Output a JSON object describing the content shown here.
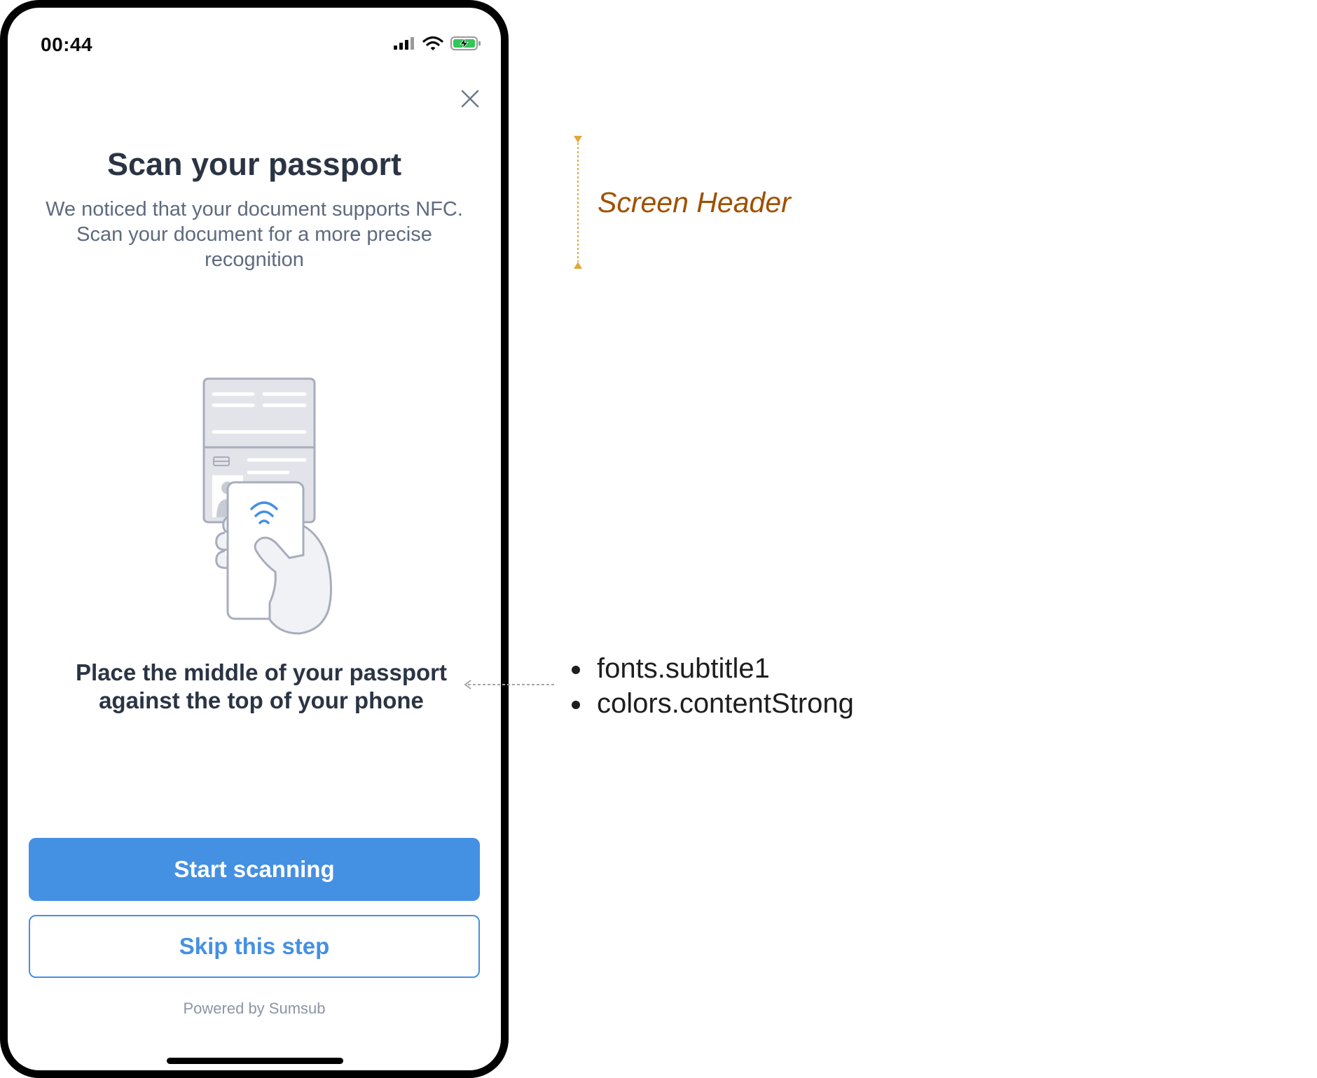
{
  "status_bar": {
    "time": "00:44"
  },
  "header": {
    "title": "Scan your passport",
    "subtitle": "We noticed that your document supports NFC. Scan your document for a more precise recognition"
  },
  "illustration": {
    "icon": "passport-nfc-illustration",
    "accent_color": "#4490e3"
  },
  "instruction": "Place the middle of your passport against the top of your phone",
  "actions": {
    "primary_label": "Start scanning",
    "secondary_label": "Skip this step"
  },
  "footer": {
    "powered_by": "Powered by Sumsub"
  },
  "annotations": {
    "header_label": "Screen Header",
    "style_notes": [
      "fonts.subtitle1",
      "colors.contentStrong"
    ]
  },
  "colors": {
    "primary": "#4490e3",
    "content_strong": "#2b3444",
    "content_neutral": "#5e6a7f",
    "annotation": "#a05000"
  }
}
